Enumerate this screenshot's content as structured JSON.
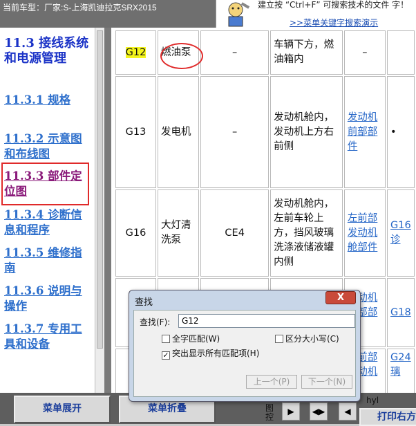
{
  "header": {
    "car_label": "当前车型：厂家:S-上海凯迪拉克SRX2015",
    "banner_text": "建立按 “Ctrl+F” 可搜索技术的文件 字！",
    "banner_link": ">>菜单关键字搜索演示"
  },
  "nav": {
    "title": "11.3 接线系统和电源管理",
    "items": [
      {
        "label": "11.3.1 规格"
      },
      {
        "label": "11.3.2 示意图和布线图"
      },
      {
        "label": "11.3.3 部件定位图"
      },
      {
        "label": "11.3.4 诊断信息和程序"
      },
      {
        "label": "11.3.5 维修指南"
      },
      {
        "label": "11.3.6 说明与操作"
      },
      {
        "label": "11.3.7 专用工具和设备"
      }
    ]
  },
  "table": {
    "rows": [
      {
        "code": "G12",
        "name": "燃油泵",
        "conn": "–",
        "loc": "车辆下方，燃油箱内",
        "link": "–",
        "extra": ""
      },
      {
        "code": "G13",
        "name": "发电机",
        "conn": "–",
        "loc": "发动机舱内，发动机上方右前侧",
        "link": "发动机前部部件",
        "extra": "•"
      },
      {
        "code": "G16",
        "name": "大灯清洗泵",
        "conn": "CE4",
        "loc": "发动机舱内，左前车轮上方，挡风玻璃洗涤液储液罐内侧",
        "link": "左前部发动机舱部件",
        "extra": "G16 诊"
      },
      {
        "code": "",
        "name": "",
        "conn": "",
        "loc": "",
        "link": "发动机前部部件",
        "extra": "G18"
      },
      {
        "code": "",
        "name": "",
        "conn": "",
        "loc": "",
        "link": "左前部发动机",
        "extra": "G24 璃"
      }
    ]
  },
  "footer": {
    "expand_label": "菜单展开",
    "collapse_label": "菜单折叠",
    "tu_label": "图控",
    "print_label": "打印右方",
    "status_text": "hyl"
  },
  "dialog": {
    "title": "查找",
    "close_label": "X",
    "find_label": "查找(F):",
    "find_value": "G12",
    "whole_word_label": "全字匹配(W)",
    "whole_word_checked": false,
    "match_case_label": "区分大小写(C)",
    "match_case_checked": false,
    "highlight_all_label": "突出显示所有匹配项(H)",
    "highlight_all_checked": true,
    "prev_label": "上一个(P)",
    "next_label": "下一个(N)"
  }
}
